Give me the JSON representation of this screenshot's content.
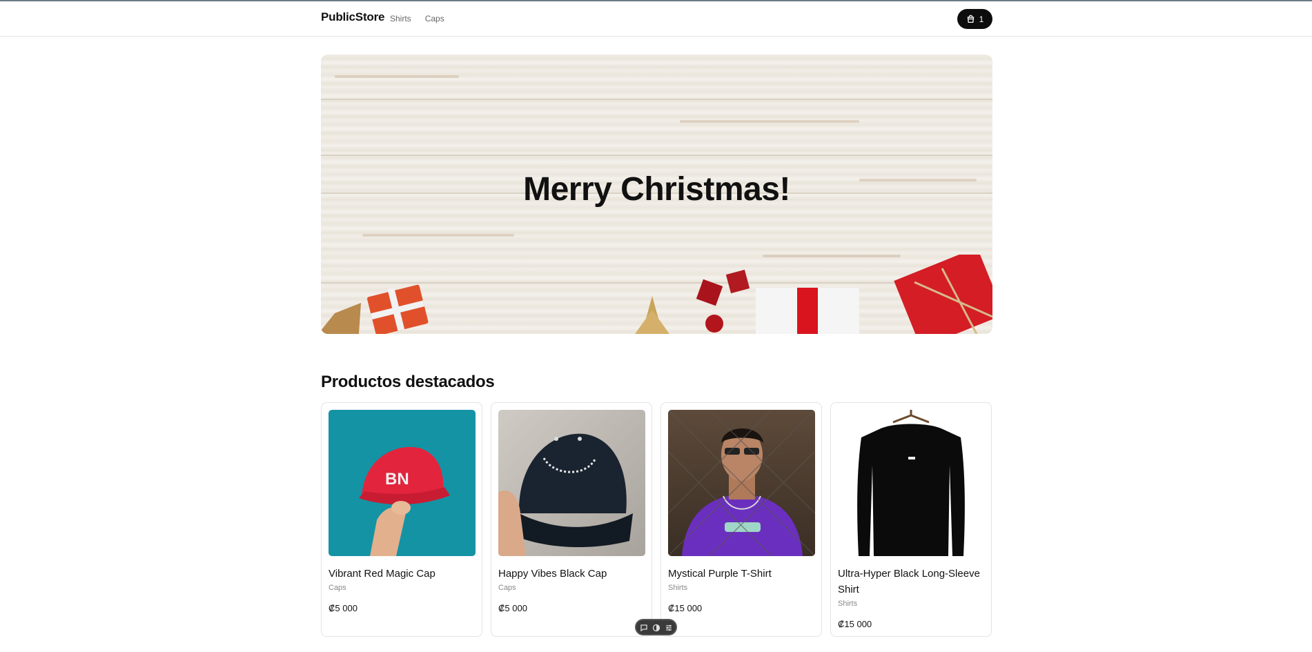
{
  "header": {
    "brand": "PublicStore",
    "nav": [
      {
        "label": "Shirts"
      },
      {
        "label": "Caps"
      }
    ],
    "cart": {
      "count": "1",
      "icon": "shopping-bag-icon"
    }
  },
  "hero": {
    "title": "Merry Christmas!"
  },
  "featured": {
    "title": "Productos destacados",
    "products": [
      {
        "name": "Vibrant Red Magic Cap",
        "category": "Caps",
        "price": "₡5 000"
      },
      {
        "name": "Happy Vibes Black Cap",
        "category": "Caps",
        "price": "₡5 000"
      },
      {
        "name": "Mystical Purple T-Shirt",
        "category": "Shirts",
        "price": "₡15 000"
      },
      {
        "name": "Ultra-Hyper Black Long-Sleeve Shirt",
        "category": "Shirts",
        "price": "₡15 000"
      }
    ]
  },
  "toolbar": {
    "icons": [
      "chat-icon",
      "theme-toggle-icon",
      "settings-icon"
    ]
  }
}
